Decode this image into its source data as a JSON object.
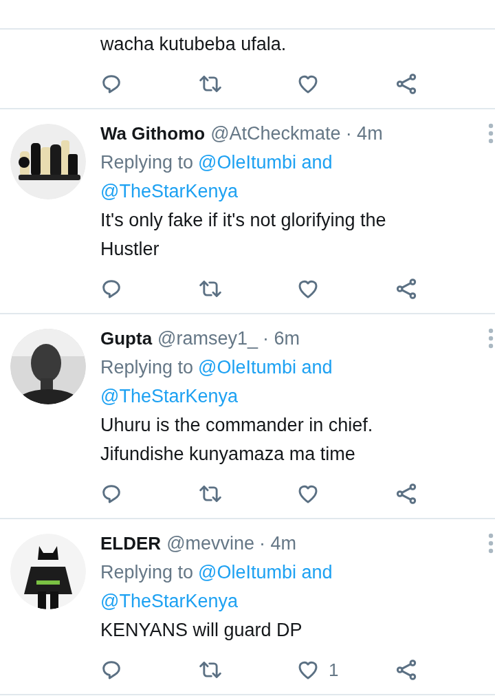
{
  "tweets": [
    {
      "kind": "continued",
      "text_lines": [
        "wacha kutubeba ufala."
      ]
    },
    {
      "kind": "reply",
      "name": "Wa Githomo",
      "handle": "@AtCheckmate",
      "time": "· 4m",
      "replying_prefix": "Replying to",
      "replying_to": "@OleItumbi and",
      "replying_to_2": "@TheStarKenya",
      "text_lines": [
        "It's only fake if it's not glorifying the",
        "Hustler"
      ],
      "avatar": {
        "kind": "picture"
      }
    },
    {
      "kind": "reply",
      "name": "Gupta",
      "handle": "@ramsey1_",
      "time": "· 6m",
      "replying_prefix": "Replying to",
      "replying_to": "@OleItumbi and",
      "replying_to_2": "@TheStarKenya",
      "text_lines": [
        "Uhuru is the commander in chief.",
        "Jifundishe kunyamaza ma time"
      ],
      "avatar": {
        "kind": "picture"
      }
    },
    {
      "kind": "reply",
      "name": "ELDER",
      "handle": "@mevvine",
      "time": "· 4m",
      "replying_prefix": "Replying to",
      "replying_to": "@OleItumbi and",
      "replying_to_2": "@TheStarKenya",
      "text_lines": [
        "KENYANS will guard DP"
      ],
      "avatar": {
        "kind": "picture"
      },
      "like_count": "1"
    }
  ]
}
